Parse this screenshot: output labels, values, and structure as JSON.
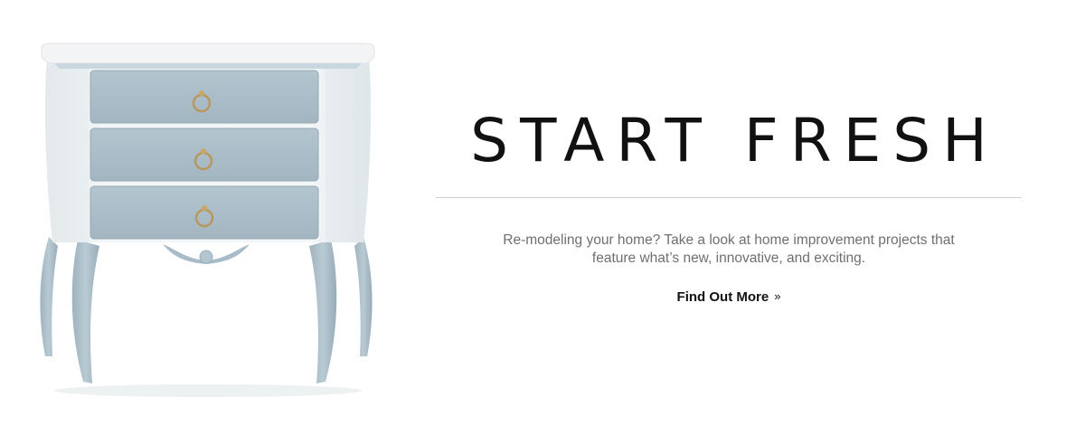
{
  "hero": {
    "image_alt": "Light blue three-drawer demilune chest",
    "headline": "START FRESH",
    "subtext": "Re-modeling your home? Take a look at home improvement projects that feature what’s new, innovative, and exciting.",
    "cta_label": "Find Out More",
    "cta_icon": "»"
  },
  "colors": {
    "background": "#ffffff",
    "headline": "#111111",
    "subtext": "#6f6f6f",
    "rule": "#cfcfcf",
    "cabinet_blue": "#a9bcc6",
    "cabinet_top": "#f1f4f5"
  }
}
